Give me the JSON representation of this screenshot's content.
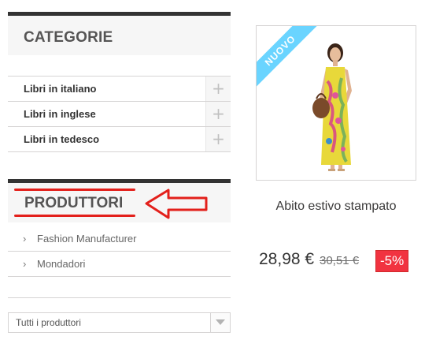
{
  "categories": {
    "title": "CATEGORIE",
    "items": [
      {
        "label": "Libri in italiano",
        "expand": "+"
      },
      {
        "label": "Libri in inglese",
        "expand": "+"
      },
      {
        "label": "Libri in tedesco",
        "expand": "+"
      }
    ]
  },
  "manufacturers": {
    "title": "PRODUTTORI",
    "items": [
      "Fashion Manufacturer",
      "Mondadori"
    ],
    "chevron": "›",
    "select_value": "Tutti i produttori"
  },
  "product": {
    "badge": "NUOVO",
    "name": "Abito estivo stampato",
    "price": "28,98 €",
    "old_price": "30,51 €",
    "reduction": "-5%"
  },
  "colors": {
    "annotation_red": "#e3201b",
    "badge_blue": "#6ad4ff",
    "reduction_red": "#f13340",
    "title_bar": "#333333"
  }
}
